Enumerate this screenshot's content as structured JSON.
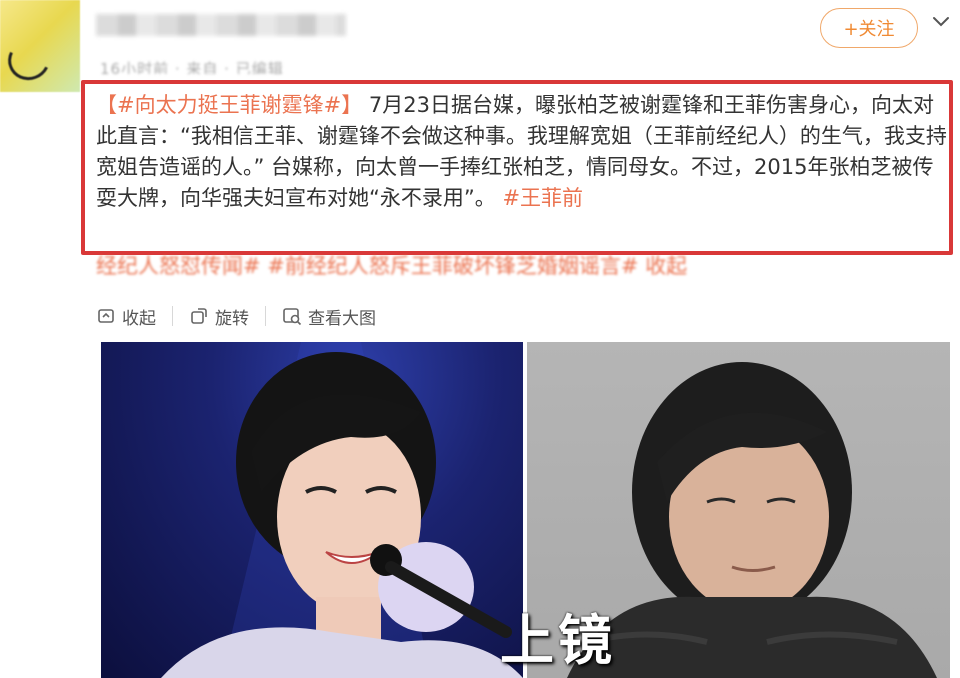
{
  "header": {
    "follow_label": "+关注",
    "meta_text": "16小时前 · 来自 · 已编辑"
  },
  "post": {
    "hashtag_main": "【#向太力挺王菲谢霆锋#】",
    "body_1": "7月23日据台媒，曝张柏芝被谢霆锋和王菲伤害身心，向太对此直言：“我相信王菲、谢霆锋不会做这种事。我理解宽姐（王菲前经纪人）的生气，我支持宽姐告造谣的人。” 台媒称，向太曾一手捧红张柏芝，情同母女。不过，2015年张柏芝被传耍大牌，向华强夫妇宣布对她“永不录用”。",
    "hashtag_tail": "#王菲前",
    "continued_line_hashtag_1": "经纪人怒怼传闻#",
    "continued_line_hashtag_2": "#前经纪人怒斥王菲破坏锋芝婚姻谣言#",
    "collapse_link": "收起"
  },
  "toolbar": {
    "collapse_label": "收起",
    "rotate_label": "旋转",
    "view_large_label": "查看大图"
  },
  "images": {
    "watermark_text": "上镜"
  },
  "colors": {
    "accent_orange": "#eb7350",
    "highlight_red": "#d93838",
    "follow_border": "#f0a86a"
  }
}
